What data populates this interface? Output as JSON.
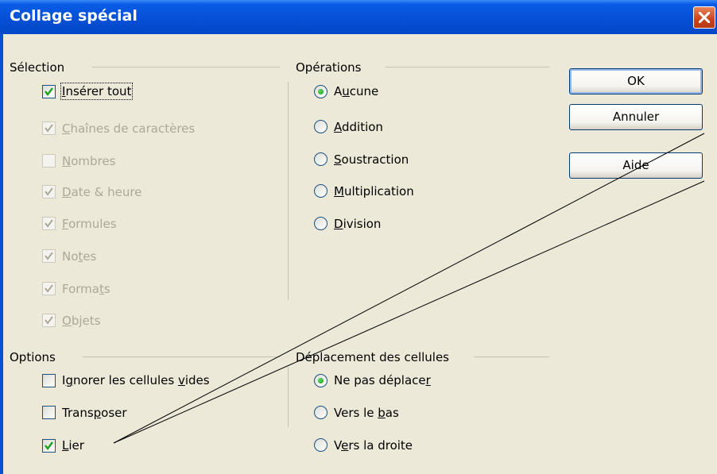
{
  "window": {
    "title": "Collage spécial"
  },
  "selection": {
    "legend": "Sélection",
    "insert_all": {
      "pre": "",
      "key": "I",
      "post": "nsérer tout",
      "checked": true
    },
    "items": [
      {
        "pre": "",
        "key": "C",
        "post": "haînes de caractères",
        "checked": true
      },
      {
        "pre": "",
        "key": "N",
        "post": "ombres",
        "checked": false
      },
      {
        "pre": "",
        "key": "D",
        "post": "ate & heure",
        "checked": true
      },
      {
        "pre": "",
        "key": "F",
        "post": "ormules",
        "checked": true
      },
      {
        "pre": "No",
        "key": "t",
        "post": "es",
        "checked": true
      },
      {
        "pre": "Forma",
        "key": "t",
        "post": "s",
        "checked": true
      },
      {
        "pre": "",
        "key": "O",
        "post": "bjets",
        "checked": true
      }
    ]
  },
  "operations": {
    "legend": "Opérations",
    "items": [
      {
        "pre": "A",
        "key": "u",
        "post": "cune",
        "selected": true
      },
      {
        "pre": "",
        "key": "A",
        "post": "ddition",
        "selected": false
      },
      {
        "pre": "",
        "key": "S",
        "post": "oustraction",
        "selected": false
      },
      {
        "pre": "",
        "key": "M",
        "post": "ultiplication",
        "selected": false
      },
      {
        "pre": "",
        "key": "D",
        "post": "ivision",
        "selected": false
      }
    ]
  },
  "options": {
    "legend": "Options",
    "items": [
      {
        "pre": "I",
        "key": "g",
        "post": "norer les cellules ",
        "key2": "v",
        "post2": "ides",
        "checked": false
      },
      {
        "pre": "Trans",
        "key": "p",
        "post": "oser",
        "key2": "",
        "post2": "",
        "checked": false
      },
      {
        "pre": "",
        "key": "L",
        "post": "ier",
        "key2": "",
        "post2": "",
        "checked": true
      }
    ]
  },
  "shift": {
    "legend": "Déplacement des cellules",
    "items": [
      {
        "pre": "Ne pas déplace",
        "key": "r",
        "post": "",
        "selected": true
      },
      {
        "pre": "Vers le ",
        "key": "b",
        "post": "as",
        "selected": false
      },
      {
        "pre": "V",
        "key": "e",
        "post": "rs la droite",
        "selected": false
      }
    ]
  },
  "buttons": {
    "ok": "OK",
    "cancel": "Annuler",
    "help": "Aide"
  },
  "colors": {
    "title_bar": "#0650d6",
    "dialog_bg": "#ece9d8",
    "close_button": "#c8431d",
    "check": "#21a121"
  }
}
